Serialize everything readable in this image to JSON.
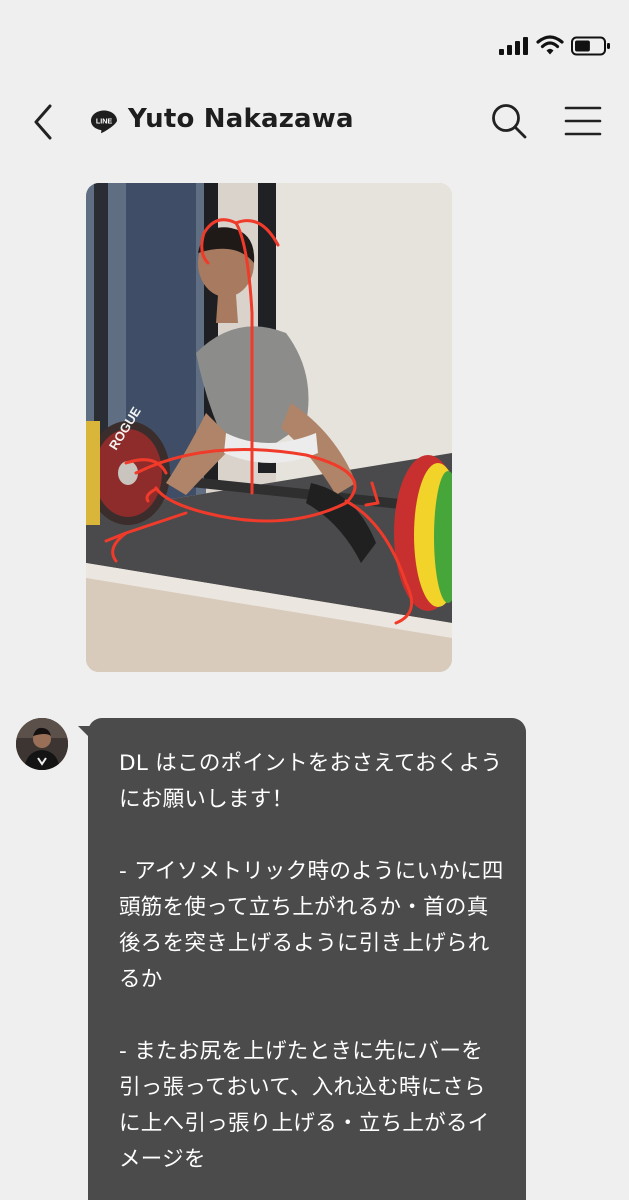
{
  "status_bar": {
    "signal_icon": "cellular-signal-icon",
    "wifi_icon": "wifi-icon",
    "battery_icon": "battery-icon",
    "battery_level": 0.55
  },
  "header": {
    "back_icon": "chevron-left-icon",
    "app_logo": "line-logo-icon",
    "app_logo_text": "LINE",
    "title": "Yuto Nakazawa",
    "search_icon": "search-icon",
    "menu_icon": "hamburger-menu-icon"
  },
  "messages": [
    {
      "type": "image",
      "direction": "incoming",
      "plate_text": "ROGUE"
    },
    {
      "type": "text",
      "direction": "incoming",
      "avatar_icon": "avatar-icon",
      "text": "DL はこのポイントをおさえておくようにお願いします！\n\n- アイソメトリック時のようにいかに四頭筋を使って立ち上がれるか・首の真後ろを突き上げるように引き上げられるか\n\n- またお尻を上げたときに先にバーを引っ張っておいて、入れ込む時にさらに上へ引っ張り上げる・立ち上がるイメージを"
    }
  ],
  "colors": {
    "background": "#efefef",
    "bubble": "#4b4b4b",
    "bubble_text": "#ffffff",
    "annotation": "#f03a2a",
    "line_green": "#06c755"
  }
}
